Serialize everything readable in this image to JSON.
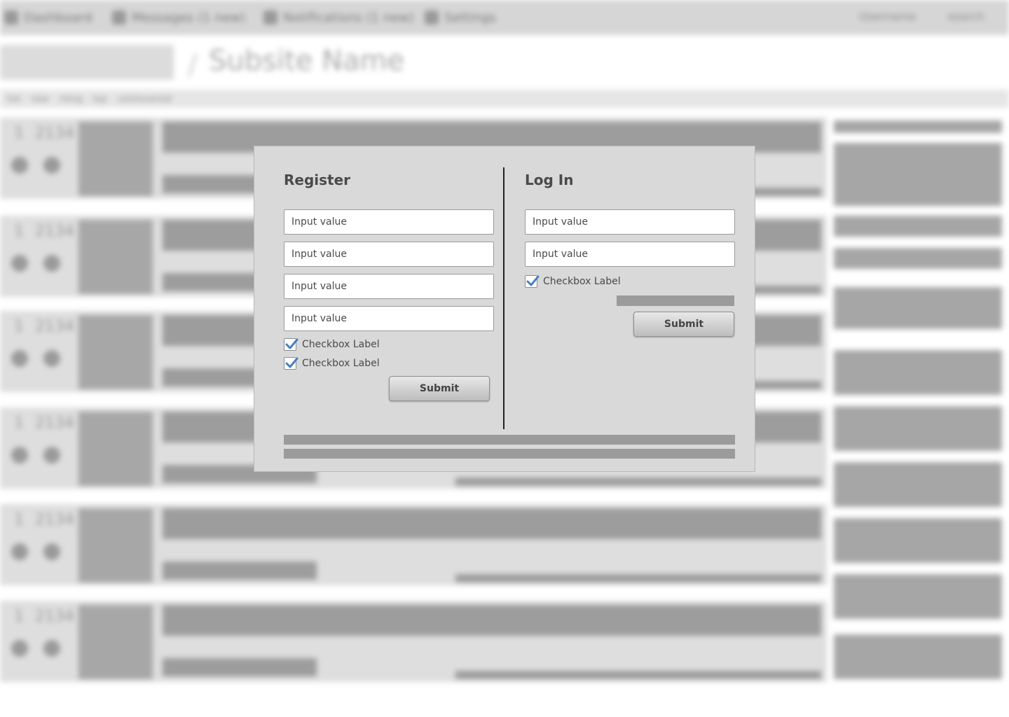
{
  "background": {
    "nav": [
      "Dashboard",
      "Messages (1 new)",
      "Notifications (1 new)",
      "Settings"
    ],
    "username": "Username",
    "search": "search",
    "site_name": "Subsite Name",
    "sub_nav": [
      "hot",
      "new",
      "rising",
      "top",
      "controversial"
    ],
    "post_rows": [
      {
        "rank": "1",
        "votes": "2134"
      },
      {
        "rank": "1",
        "votes": "2134"
      },
      {
        "rank": "1",
        "votes": "2134"
      },
      {
        "rank": "1",
        "votes": "2134"
      },
      {
        "rank": "1",
        "votes": "2134"
      },
      {
        "rank": "1",
        "votes": "2134"
      }
    ]
  },
  "modal": {
    "register": {
      "title": "Register",
      "fields": [
        "Input value",
        "Input value",
        "Input value",
        "Input value"
      ],
      "checkboxes": [
        {
          "label": "Checkbox Label",
          "checked": true
        },
        {
          "label": "Checkbox Label",
          "checked": true
        }
      ],
      "submit_label": "Submit"
    },
    "login": {
      "title": "Log In",
      "fields": [
        "Input value",
        "Input value"
      ],
      "checkbox": {
        "label": "Checkbox Label",
        "checked": true
      },
      "submit_label": "Submit"
    }
  },
  "colors": {
    "check_accent": "#4a7fc0",
    "modal_bg": "#d9d9d9",
    "placeholder_bar": "#9b9b9b"
  }
}
